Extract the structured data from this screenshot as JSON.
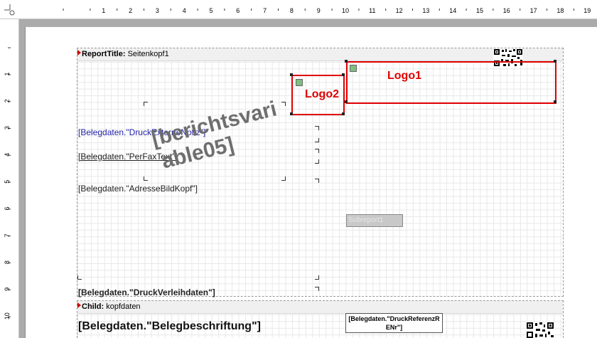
{
  "rulers": {
    "horizontal_numbers": [
      "1",
      "2",
      "3",
      "4",
      "5",
      "6",
      "7",
      "8",
      "9",
      "10",
      "11",
      "12",
      "13",
      "14",
      "15",
      "16",
      "17",
      "18",
      "19"
    ],
    "vertical_numbers": [
      "1",
      "2",
      "3",
      "4",
      "5",
      "6",
      "7",
      "8",
      "9",
      "10"
    ]
  },
  "band_report_title": {
    "kind": "ReportTitle:",
    "name": "Seitenkopf1"
  },
  "band_child": {
    "kind": "Child:",
    "name": "kopfdaten"
  },
  "fields": {
    "druck_externe_notiz": "[Belegdaten.\"DruckExterneNotiz\"]",
    "per_fax_text": "[Belegdaten.\"PerFaxText\"]",
    "adresse_bild_kopf": "[Belegdaten.\"AdresseBildKopf\"]",
    "druck_verleihdaten": "[Belegdaten.\"DruckVerleihdaten\"]",
    "belegbeschriftung": "[Belegdaten.\"Belegbeschriftung\"]",
    "druck_referenz_line1": "[Belegdaten.\"DruckReferenzR",
    "druck_referenz_line2": "ENr\"]"
  },
  "watermark": {
    "line1": "[berichtsvari",
    "line2": "able05]"
  },
  "logos": {
    "logo1": "Logo1",
    "logo2": "Logo2"
  },
  "subreport": "Subreport1",
  "colors": {
    "accent_red": "#e00000",
    "blue_field": "#2222aa"
  }
}
